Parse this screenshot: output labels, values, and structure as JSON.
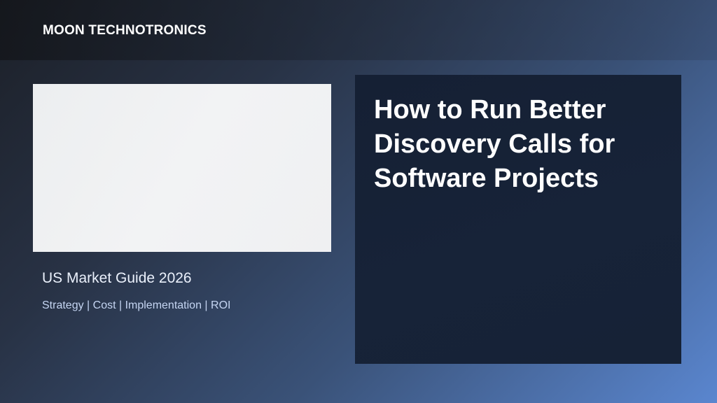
{
  "header": {
    "brand": "MOON TECHNOTRONICS"
  },
  "hero_image": {
    "icon": "image-placeholder"
  },
  "guide": {
    "title": "US Market Guide 2026",
    "subtitle": "Strategy | Cost | Implementation | ROI"
  },
  "card": {
    "title": "How to Run Better Discovery Calls for Software Projects"
  },
  "colors": {
    "background_start": "#1c2028",
    "background_end": "#5a86cf",
    "card_background": "#152034",
    "placeholder": "#f0f1f2",
    "text_primary": "#ffffff",
    "text_secondary": "#c5d5f2"
  }
}
